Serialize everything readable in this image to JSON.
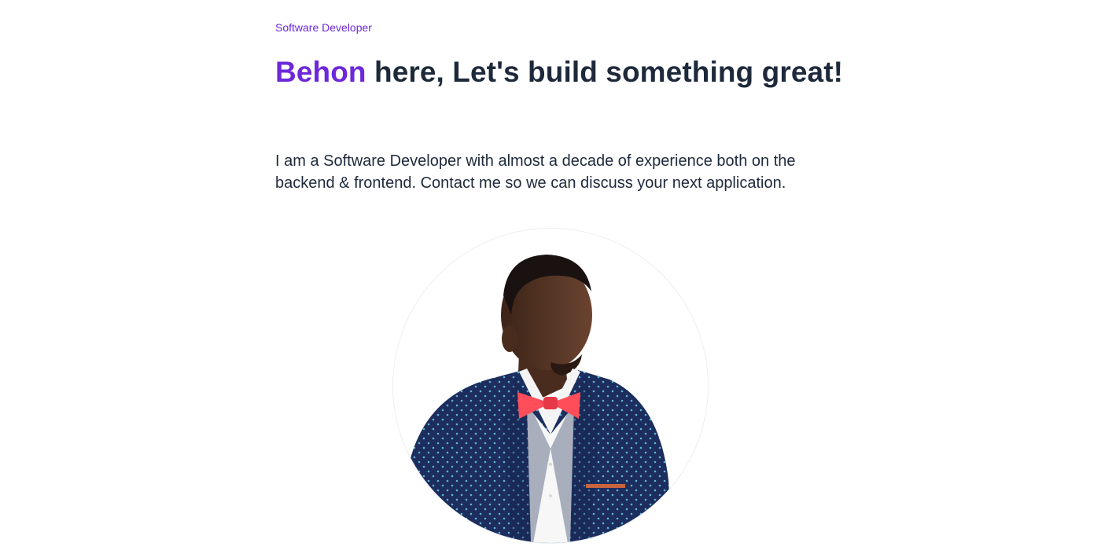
{
  "hero": {
    "eyebrow": "Software Developer",
    "headline_name": "Behon",
    "headline_rest": " here, Let's build something great!",
    "intro": "I am a Software Developer with almost a decade of experience both on the backend & frontend. Contact me so we can discuss your next application."
  },
  "portrait": {
    "icon": "profile-photo"
  },
  "colors": {
    "accent": "#6d28d9",
    "text": "#1e293b",
    "background": "#ffffff"
  }
}
